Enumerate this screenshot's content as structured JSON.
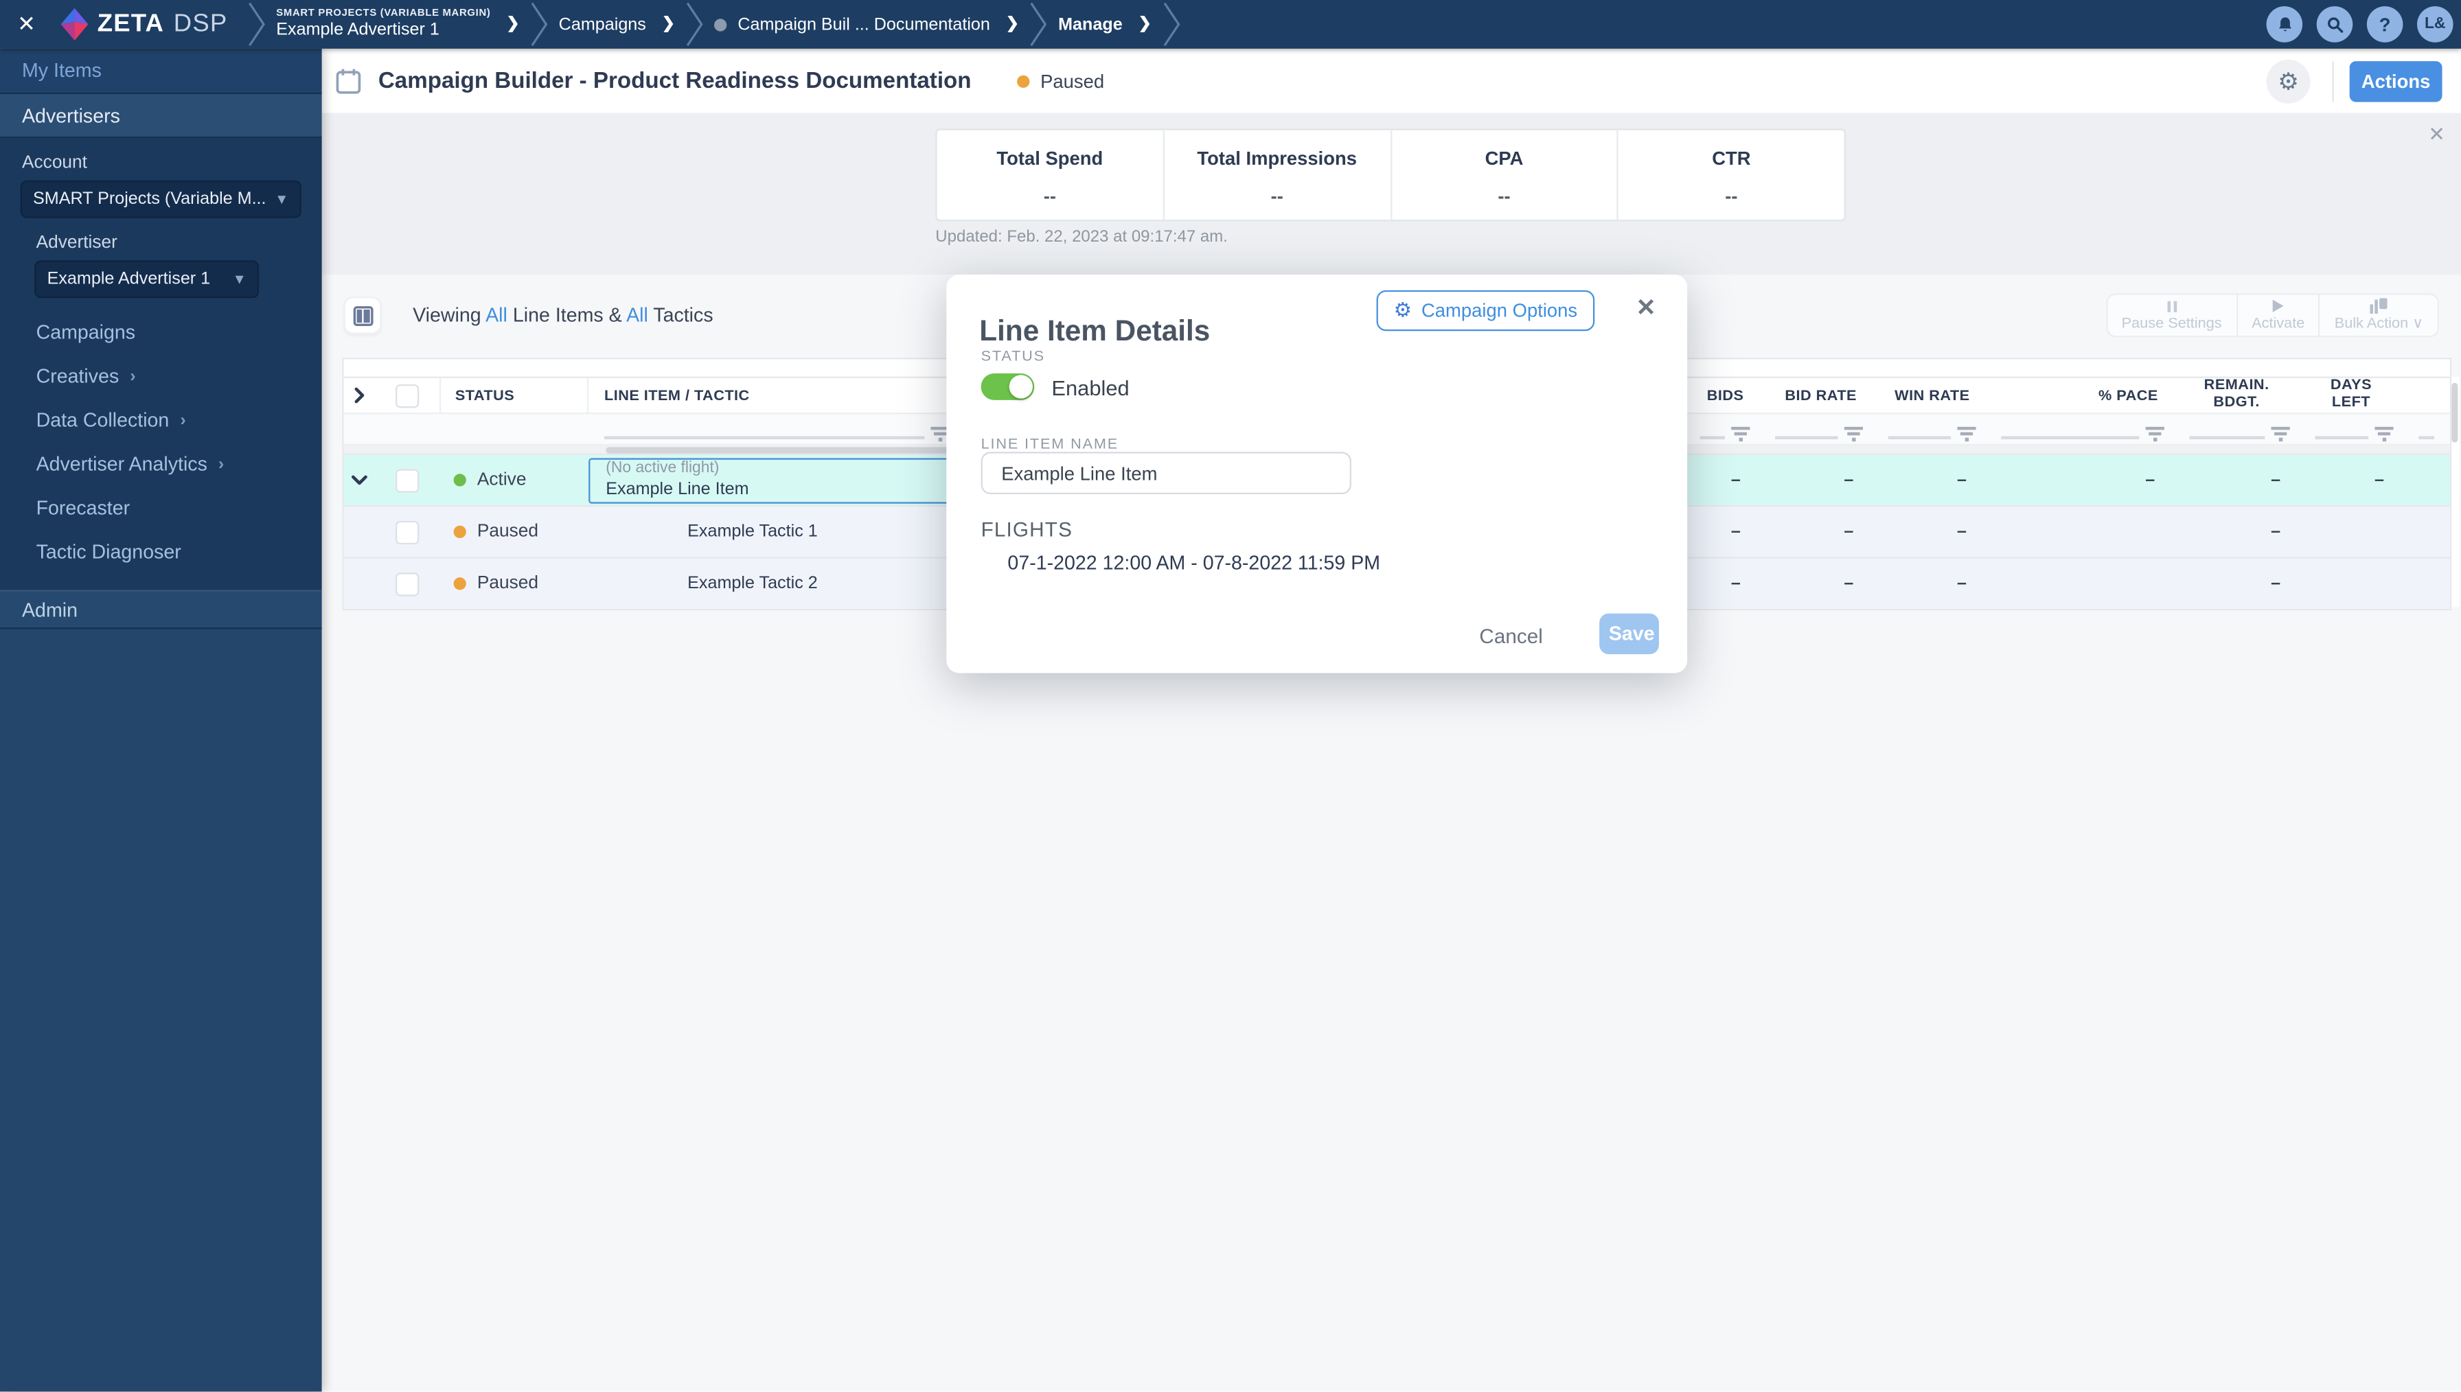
{
  "topbar": {
    "logo": {
      "brand": "ZETA",
      "suffix": "DSP"
    },
    "breadcrumbs": {
      "account_line1": "SMART PROJECTS (VARIABLE MARGIN)",
      "account_line2": "Example Advertiser 1",
      "campaigns": "Campaigns",
      "campaign": "Campaign Buil ... Documentation",
      "manage": "Manage"
    },
    "avatar": "L&",
    "help": "?"
  },
  "sidebar": {
    "my_items": "My Items",
    "advertisers": "Advertisers",
    "account_label": "Account",
    "account_value": "SMART Projects (Variable M...",
    "advertiser_label": "Advertiser",
    "advertiser_value": "Example Advertiser 1",
    "items": [
      {
        "label": "Campaigns"
      },
      {
        "label": "Creatives"
      },
      {
        "label": "Data Collection"
      },
      {
        "label": "Advertiser Analytics"
      },
      {
        "label": "Forecaster"
      },
      {
        "label": "Tactic Diagnoser"
      }
    ],
    "admin": "Admin"
  },
  "header": {
    "title": "Campaign Builder - Product Readiness Documentation",
    "status": "Paused",
    "actions": "Actions"
  },
  "stats": {
    "cards": [
      {
        "label": "Total Spend",
        "value": "--"
      },
      {
        "label": "Total Impressions",
        "value": "--"
      },
      {
        "label": "CPA",
        "value": "--"
      },
      {
        "label": "CTR",
        "value": "--"
      }
    ],
    "updated": "Updated: Feb. 22, 2023 at 09:17:47 am."
  },
  "toolbar": {
    "viewing": {
      "prefix": "Viewing",
      "all1": "All",
      "mid": "Line Items &",
      "all2": "All",
      "suffix": "Tactics"
    },
    "pause_settings": "Pause Settings",
    "activate": "Activate",
    "bulk_action": "Bulk Action"
  },
  "table": {
    "columns": {
      "status": "STATUS",
      "line_item": "LINE ITEM / TACTIC",
      "bids": "BIDS",
      "bid_rate": "BID RATE",
      "win_rate": "WIN RATE",
      "pace": "% PACE",
      "remain1": "REMAIN.",
      "remain2": "BDGT.",
      "days1": "DAYS",
      "days2": "LEFT"
    },
    "rows": [
      {
        "status": "Active",
        "flight_note": "(No active flight)",
        "name": "Example Line Item",
        "bids": "–",
        "bid_rate": "–",
        "win_rate": "–",
        "pace": "–",
        "remain": "–",
        "days": "–"
      },
      {
        "status": "Paused",
        "name": "Example Tactic 1",
        "bids": "–",
        "bid_rate": "–",
        "win_rate": "–",
        "pace": "",
        "remain": "–",
        "days": ""
      },
      {
        "status": "Paused",
        "name": "Example Tactic 2",
        "bids": "–",
        "bid_rate": "–",
        "win_rate": "–",
        "pace": "",
        "remain": "–",
        "days": ""
      }
    ]
  },
  "modal": {
    "title": "Line Item Details",
    "campaign_options": "Campaign Options",
    "status_label": "STATUS",
    "status_value": "Enabled",
    "name_label": "LINE ITEM NAME",
    "name_value": "Example Line Item",
    "flights_label": "FLIGHTS",
    "flight_range": "07-1-2022 12:00 AM - 07-8-2022 11:59 PM",
    "cancel": "Cancel",
    "save": "Save"
  },
  "colors": {
    "accent": "#4A90E2",
    "active_dot": "#6DBE4B",
    "paused_dot": "#ECA33D",
    "toggle_on": "#6CC24A",
    "selected_row": "#D7F9F4"
  }
}
